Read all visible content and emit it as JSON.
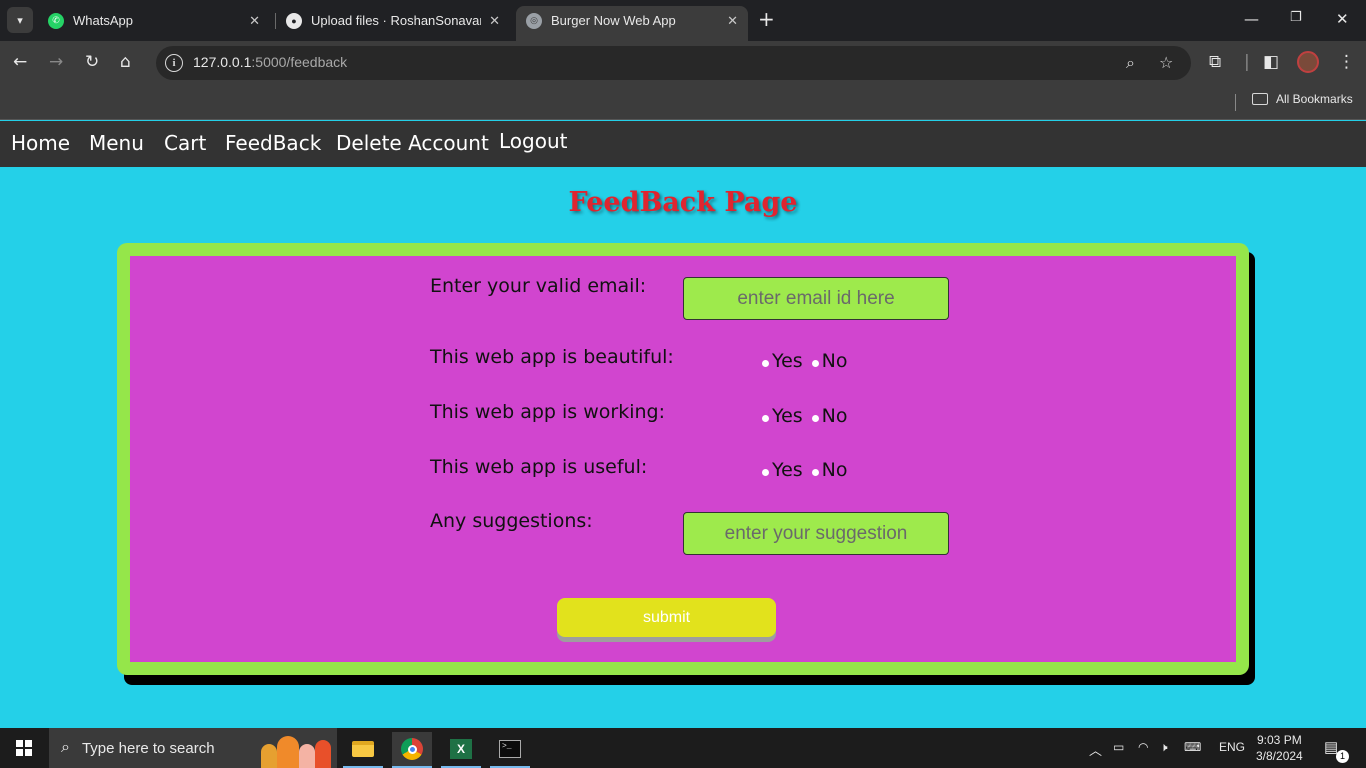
{
  "browser": {
    "tabs": [
      {
        "label": "WhatsApp"
      },
      {
        "label": "Upload files · RoshanSonavane/"
      },
      {
        "label": "Burger Now Web App"
      }
    ],
    "url_host": "127.0.0.1",
    "url_rest": ":5000/feedback",
    "bookmarks_label": "All Bookmarks"
  },
  "nav": {
    "items": [
      "Home",
      "Menu",
      "Cart",
      "FeedBack",
      "Delete Account",
      "Logout"
    ]
  },
  "page": {
    "title": "FeedBack Page"
  },
  "form": {
    "email_label": "Enter your valid email:",
    "email_placeholder": "enter email id here",
    "questions": [
      {
        "label": "This web app is beautiful:",
        "yes": "Yes",
        "no": "No"
      },
      {
        "label": "This web app is working:",
        "yes": "Yes",
        "no": "No"
      },
      {
        "label": "This web app is useful:",
        "yes": "Yes",
        "no": "No"
      }
    ],
    "suggest_label": "Any suggestions:",
    "suggest_placeholder": "enter your suggestion",
    "submit_label": "submit"
  },
  "taskbar": {
    "search_placeholder": "Type here to search",
    "lang": "ENG",
    "time": "9:03 PM",
    "date": "3/8/2024",
    "notif_count": "1"
  }
}
